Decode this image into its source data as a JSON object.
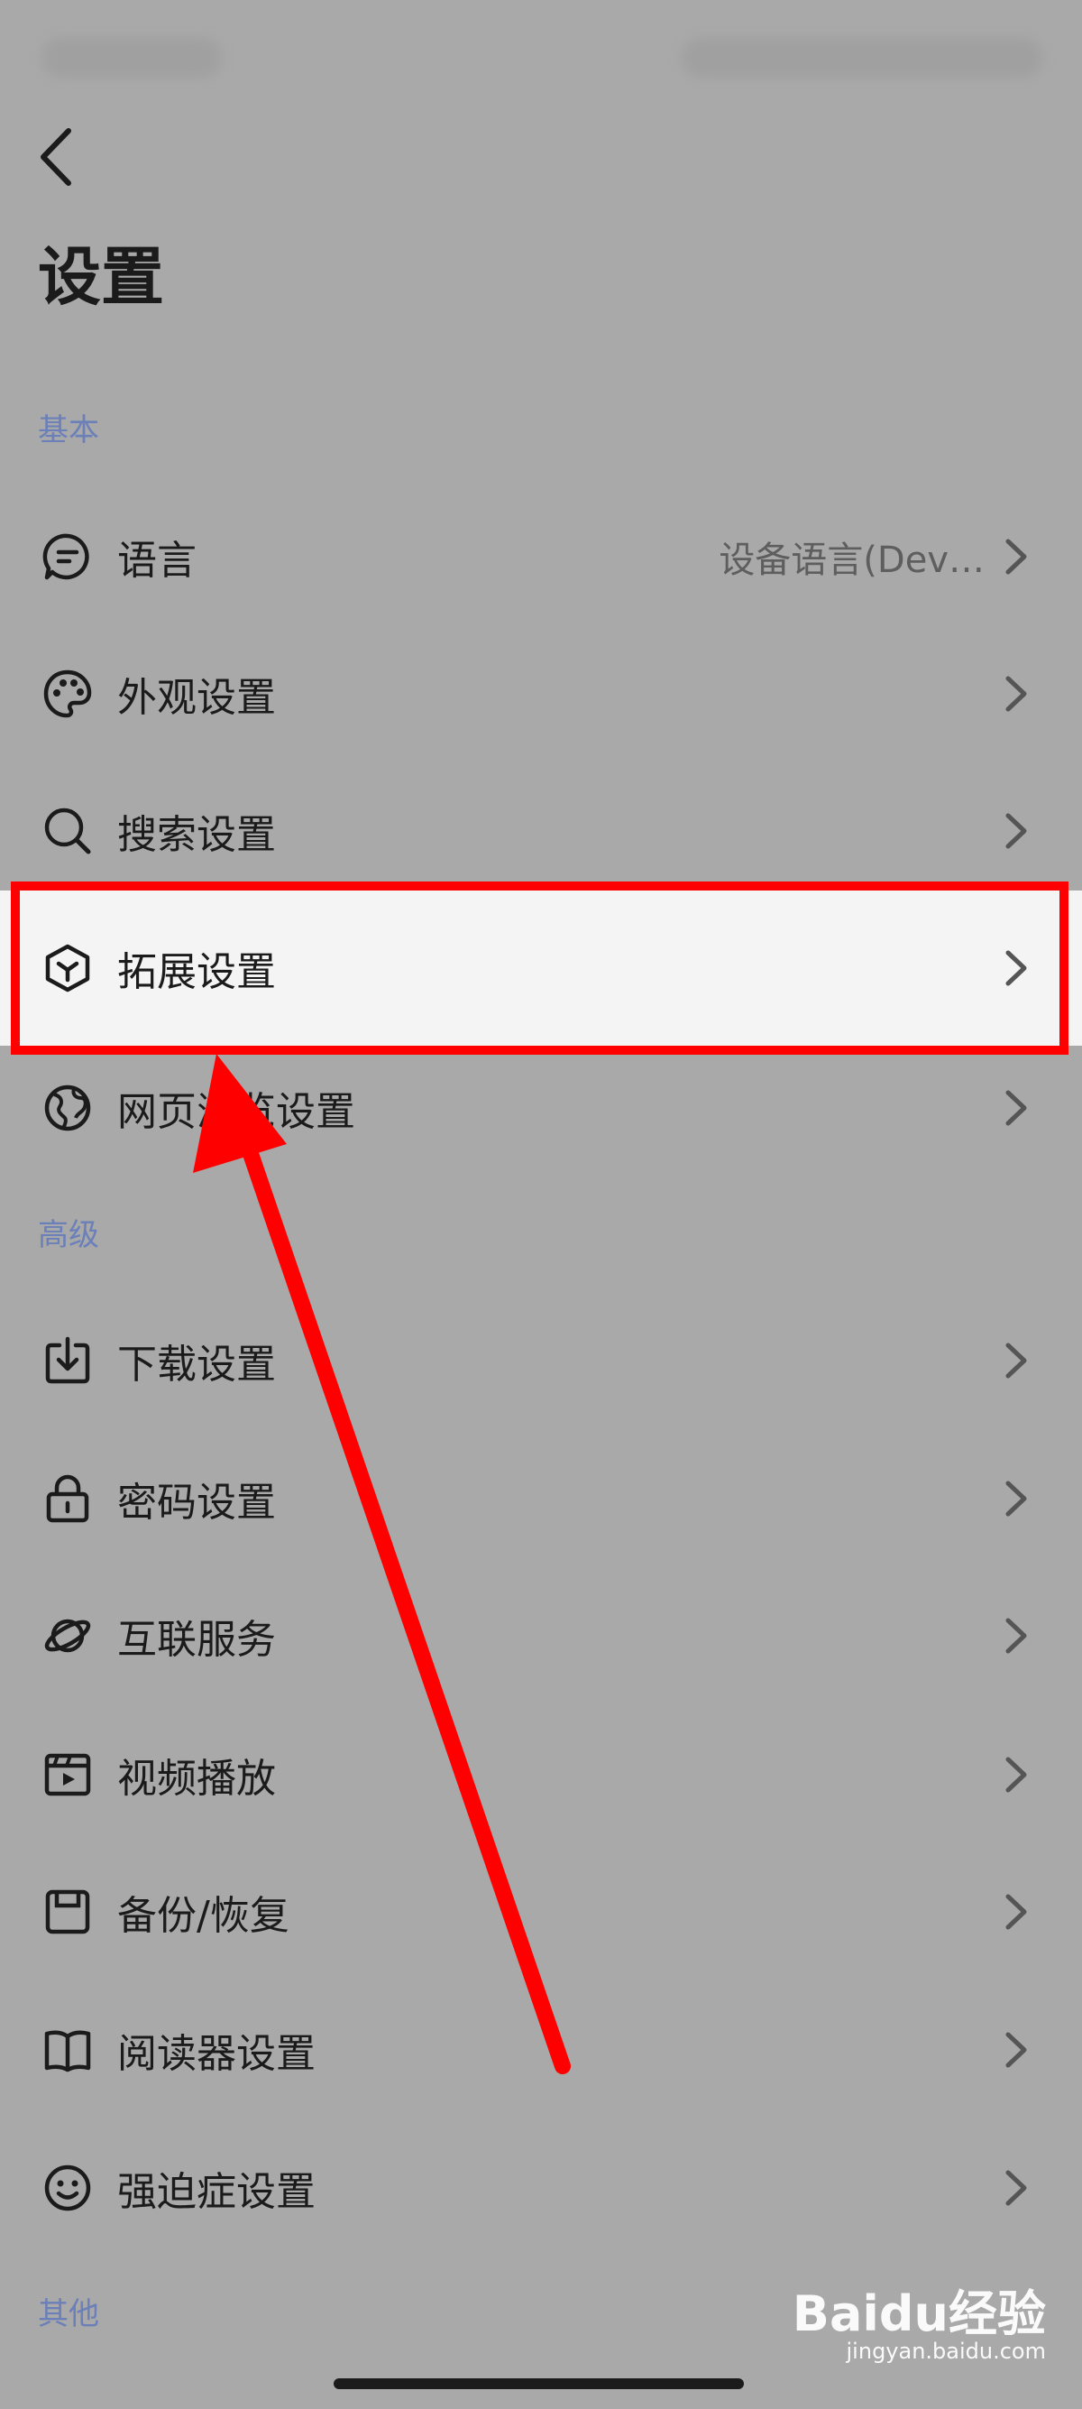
{
  "header": {
    "title": "设置"
  },
  "sections": {
    "basic": "基本",
    "advanced": "高级",
    "other": "其他"
  },
  "rows": {
    "language": {
      "label": "语言",
      "value": "设备语言(Dev…",
      "icon": "message-bubble-icon"
    },
    "appearance": {
      "label": "外观设置",
      "icon": "palette-icon"
    },
    "search": {
      "label": "搜索设置",
      "icon": "search-icon"
    },
    "extensions": {
      "label": "拓展设置",
      "icon": "cube-icon",
      "highlighted": true
    },
    "browsing": {
      "label": "网页浏览设置",
      "icon": "globe-icon"
    },
    "download": {
      "label": "下载设置",
      "icon": "download-icon"
    },
    "password": {
      "label": "密码设置",
      "icon": "lock-icon"
    },
    "services": {
      "label": "互联服务",
      "icon": "planet-icon"
    },
    "video": {
      "label": "视频播放",
      "icon": "video-icon"
    },
    "backup": {
      "label": "备份/恢复",
      "icon": "save-icon"
    },
    "reader": {
      "label": "阅读器设置",
      "icon": "book-icon"
    },
    "ocd": {
      "label": "强迫症设置",
      "icon": "smiley-icon"
    }
  },
  "watermark": {
    "logo": "Baidu经验",
    "url": "jingyan.baidu.com"
  },
  "colors": {
    "background": "#a9a9a9",
    "highlight_row": "#f4f4f4",
    "annotation_red": "#ff0000",
    "section_label": "#6b7fb8"
  }
}
